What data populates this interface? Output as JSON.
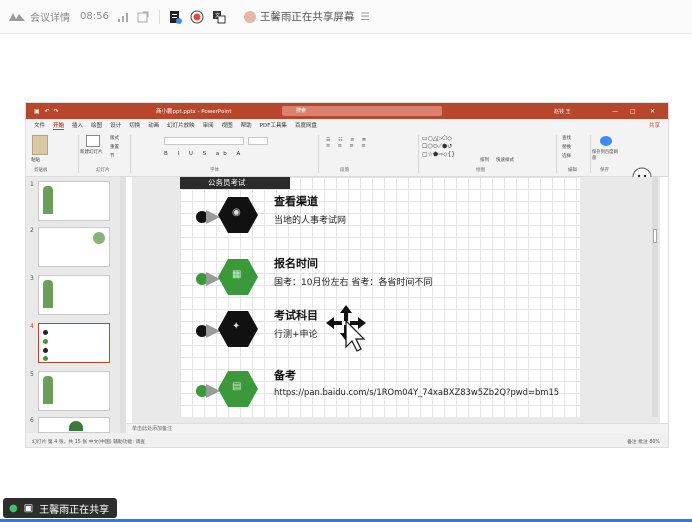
{
  "meeting": {
    "detail_label": "会议详情",
    "time": "08:56",
    "sharer_status": "王馨雨正在共享屏幕"
  },
  "ppt": {
    "file_name": "商小鹏ppt.pptx - PowerPoint",
    "search_placeholder": "搜索",
    "user": "赵钱 王",
    "tabs": [
      "文件",
      "开始",
      "插入",
      "绘图",
      "设计",
      "切换",
      "动画",
      "幻灯片放映",
      "审阅",
      "视图",
      "帮助",
      "PDF工具集",
      "百度网盘"
    ],
    "active_tab": "开始",
    "share_label": "共享",
    "ribbon_groups": [
      "剪贴板",
      "幻灯片",
      "字体",
      "段落",
      "绘图",
      "编辑",
      "保存"
    ],
    "ribbon_buttons": [
      "粘贴",
      "新建幻灯片",
      "版式",
      "重置",
      "节",
      "替换",
      "选择",
      "查找",
      "保存到百度网盘",
      "排列",
      "快速样式"
    ],
    "notes_placeholder": "单击此处添加备注",
    "status_left": "幻灯片 第 4 张，共 15 张    中文(中国)    辅助功能: 调查",
    "status_right": "备注   批注   80%",
    "thumb_numbers": [
      "1",
      "2",
      "3",
      "4",
      "5",
      "6"
    ],
    "selected_thumb": "4"
  },
  "slide": {
    "header": "公务员考试",
    "rows": [
      {
        "title": "查看渠道",
        "sub": "当地的人事考试网",
        "color": "#111111"
      },
      {
        "title": "报名时间",
        "sub": "国考：10月份左右    省考：各省时间不同",
        "color": "#3a9a3a"
      },
      {
        "title": "考试科目",
        "sub": "行测+申论",
        "color": "#111111"
      },
      {
        "title": "备考",
        "sub": "https://pan.baidu.com/s/1ROm04Y_74xaBXZ83w5Zb2Q?pwd=bm15",
        "color": "#3a9a3a"
      }
    ]
  },
  "share_pill": {
    "label": "王馨雨正在共享"
  }
}
